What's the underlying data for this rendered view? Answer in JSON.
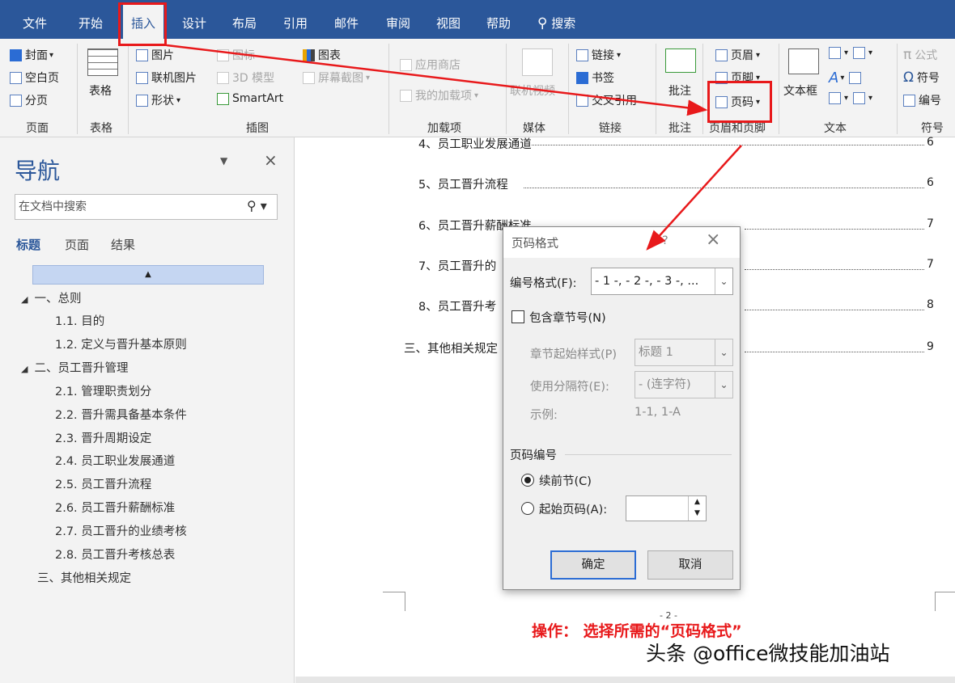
{
  "tabs": [
    "文件",
    "开始",
    "插入",
    "设计",
    "布局",
    "引用",
    "邮件",
    "审阅",
    "视图",
    "帮助"
  ],
  "search_label": "搜索",
  "ribbon": {
    "pages": {
      "cover": "封面",
      "blank": "空白页",
      "break": "分页",
      "group": "页面"
    },
    "table": {
      "label": "表格",
      "group": "表格"
    },
    "illus": {
      "picture": "图片",
      "online_picture": "联机图片",
      "shapes": "形状",
      "icons": "图标",
      "model3d": "3D 模型",
      "smartart": "SmartArt",
      "chart": "图表",
      "screenshot": "屏幕截图",
      "group": "插图"
    },
    "addins": {
      "store": "应用商店",
      "my": "我的加载项",
      "group": "加载项"
    },
    "media": {
      "video": "联机视频",
      "group": "媒体"
    },
    "links": {
      "link": "链接",
      "bookmark": "书签",
      "crossref": "交叉引用",
      "group": "链接"
    },
    "comments": {
      "comment": "批注",
      "group": "批注"
    },
    "header_footer": {
      "header": "页眉",
      "footer": "页脚",
      "page_number": "页码",
      "group": "页眉和页脚"
    },
    "text": {
      "textbox": "文本框",
      "group": "文本"
    },
    "symbols": {
      "equation": "公式",
      "symbol": "符号",
      "numbering": "编号",
      "group": "符号"
    }
  },
  "nav": {
    "title": "导航",
    "search_placeholder": "在文档中搜索",
    "tabs": [
      "标题",
      "页面",
      "结果"
    ],
    "items": [
      {
        "text": "一、总则",
        "level": 1
      },
      {
        "text": "1.1. 目的",
        "level": 2
      },
      {
        "text": "1.2. 定义与晋升基本原则",
        "level": 2
      },
      {
        "text": "二、员工晋升管理",
        "level": 1
      },
      {
        "text": "2.1. 管理职责划分",
        "level": 2
      },
      {
        "text": "2.2. 晋升需具备基本条件",
        "level": 2
      },
      {
        "text": "2.3. 晋升周期设定",
        "level": 2
      },
      {
        "text": "2.4. 员工职业发展通道",
        "level": 2
      },
      {
        "text": "2.5. 员工晋升流程",
        "level": 2
      },
      {
        "text": "2.6. 员工晋升薪酬标准",
        "level": 2
      },
      {
        "text": "2.7. 员工晋升的业绩考核",
        "level": 2
      },
      {
        "text": "2.8. 员工晋升考核总表",
        "level": 2
      },
      {
        "text": "三、其他相关规定",
        "level": 1
      }
    ]
  },
  "doc": {
    "toc": [
      {
        "text": "4、员工职业发展通道",
        "page": "6"
      },
      {
        "text": "5、员工晋升流程",
        "page": "6"
      },
      {
        "text": "6、员工晋升薪酬标准",
        "page": "7"
      },
      {
        "text": "7、员工晋升的",
        "page": "7"
      },
      {
        "text": "8、员工晋升考",
        "page": "8"
      },
      {
        "text": "三、其他相关规定",
        "page": "9"
      }
    ],
    "page_footer": "- 2 -",
    "instruction": "操作： 选择所需的“页码格式”",
    "watermark": "头条 @office微技能加油站"
  },
  "dialog": {
    "title": "页码格式",
    "help": "?",
    "close": "×",
    "format_label": "编号格式(F):",
    "format_value": "- 1 -, - 2 -, - 3 -, ...",
    "include_chapter": "包含章节号(N)",
    "chapter_style_label": "章节起始样式(P)",
    "chapter_style_value": "标题 1",
    "separator_label": "使用分隔符(E):",
    "separator_value": "-  (连字符)",
    "example_label": "示例:",
    "example_value": "1-1, 1-A",
    "numbering_section": "页码编号",
    "continue": "续前节(C)",
    "start_at": "起始页码(A):",
    "ok": "确定",
    "cancel": "取消"
  },
  "colors": {
    "accent": "#2b579a",
    "highlight": "#e8191b"
  }
}
